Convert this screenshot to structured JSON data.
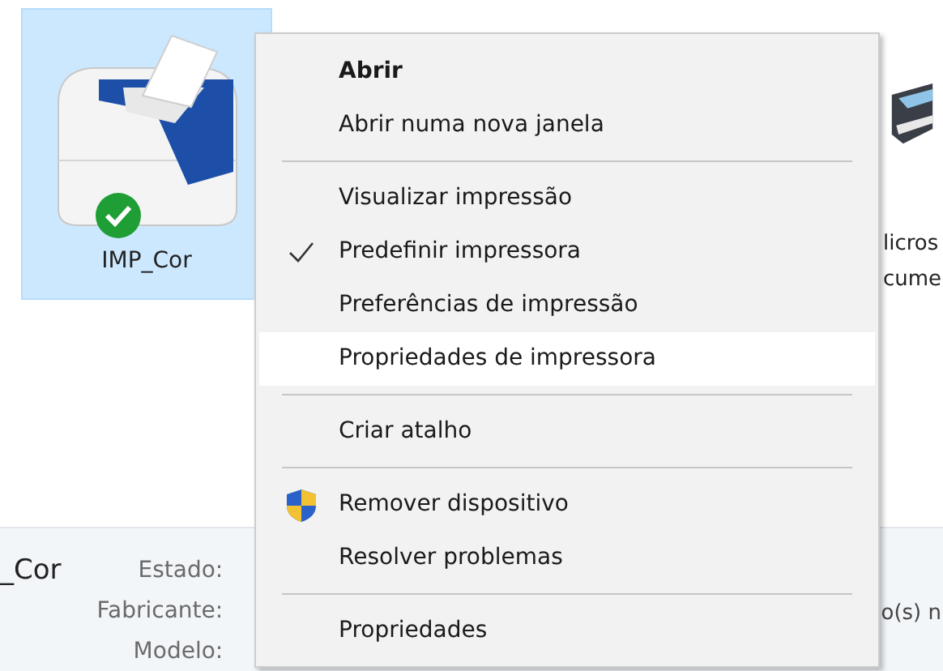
{
  "desktop_items": [
    {
      "lines": [
        "IMP_Cor"
      ],
      "selected": true,
      "is_default": true
    },
    {
      "lines": [
        "licros",
        "cume"
      ],
      "selected": false,
      "is_default": false
    }
  ],
  "details": {
    "name": "_Cor",
    "fields": [
      {
        "label": "Estado:"
      },
      {
        "label": "Fabricante:"
      },
      {
        "label": "Modelo:"
      }
    ],
    "fragment": "o(s) n"
  },
  "context_menu": [
    {
      "kind": "item",
      "label": "Abrir",
      "default": true,
      "checked": false,
      "selected": false
    },
    {
      "kind": "item",
      "label": "Abrir numa nova janela",
      "default": false,
      "checked": false,
      "selected": false
    },
    {
      "kind": "separator"
    },
    {
      "kind": "item",
      "label": "Visualizar impressão",
      "default": false,
      "checked": false,
      "selected": false
    },
    {
      "kind": "item",
      "label": "Predefinir impressora",
      "default": false,
      "checked": true,
      "selected": false
    },
    {
      "kind": "item",
      "label": "Preferências de impressão",
      "default": false,
      "checked": false,
      "selected": false
    },
    {
      "kind": "item",
      "label": "Propriedades de impressora",
      "default": false,
      "checked": false,
      "selected": true
    },
    {
      "kind": "separator"
    },
    {
      "kind": "item",
      "label": "Criar atalho",
      "default": false,
      "checked": false,
      "selected": false
    },
    {
      "kind": "separator"
    },
    {
      "kind": "admin",
      "label": "Remover dispositivo",
      "default": false,
      "checked": false,
      "selected": false
    },
    {
      "kind": "item",
      "label": "Resolver problemas",
      "default": false,
      "checked": false,
      "selected": false
    },
    {
      "kind": "separator"
    },
    {
      "kind": "item",
      "label": "Propriedades",
      "default": false,
      "checked": false,
      "selected": false
    }
  ]
}
